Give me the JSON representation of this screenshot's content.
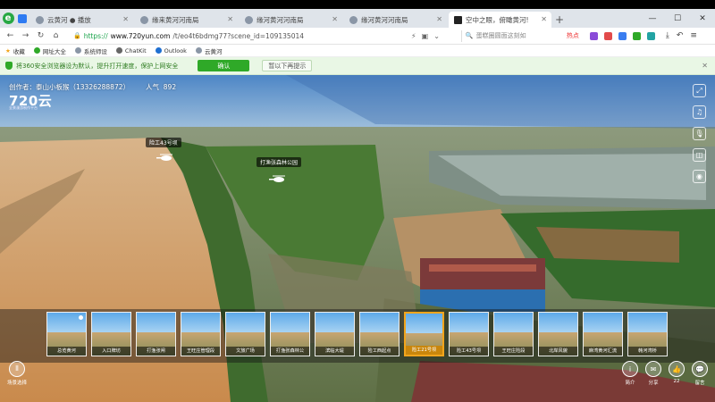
{
  "tabs": [
    {
      "label": "云黄河 ● 播放",
      "active": false
    },
    {
      "label": "缘来黄河河南局",
      "active": false
    },
    {
      "label": "缘河黄河河南局",
      "active": false
    },
    {
      "label": "缘河黄河河南局",
      "active": false
    },
    {
      "label": "空中之眼，俯瞰黄河!",
      "active": true
    }
  ],
  "address": {
    "protocol": "https://",
    "host": "www.720yun.com",
    "path": "/t/eo4t6bdmg77?scene_id=109135014",
    "search_placeholder": "蛋糕圈圆面这刻如",
    "hot_label": "热点"
  },
  "bookmarks": [
    "收藏",
    "网址大全",
    "系统师设",
    "ChatKit",
    "Outlook",
    "云黄河"
  ],
  "notice": {
    "text": "将360安全浏览器设为默认，提升打开速度，保护上网安全",
    "confirm": "确认",
    "later": "暂以下再提示"
  },
  "viewer": {
    "author_label": "创作者：泰山小板猴（13326288872）",
    "views_label": "人气",
    "views": "892",
    "brand": "720云",
    "brand_sub": "全景漫游制作平台",
    "hotspots": [
      {
        "label": "险工43号坝"
      },
      {
        "label": "打渔张森林公园"
      }
    ],
    "thumbnails": [
      "总览黄河",
      "入口牌坊",
      "打渔张闸",
      "王旺庄管理段",
      "文旅广场",
      "打渔张森林公",
      "滨临大堤",
      "险工西起点",
      "险工21号坝",
      "险工43号坝",
      "王旺庄险段",
      "北岸风貌",
      "麻湾黄河汇流",
      "韩河湾桥"
    ],
    "active_thumb": 8,
    "bottom_left": "场景选择",
    "bottom_right": [
      {
        "icon": "i",
        "label": "简介"
      },
      {
        "icon": "✉",
        "label": "分享"
      },
      {
        "icon": "👍",
        "label": "22"
      },
      {
        "icon": "💬",
        "label": "留言"
      }
    ]
  }
}
